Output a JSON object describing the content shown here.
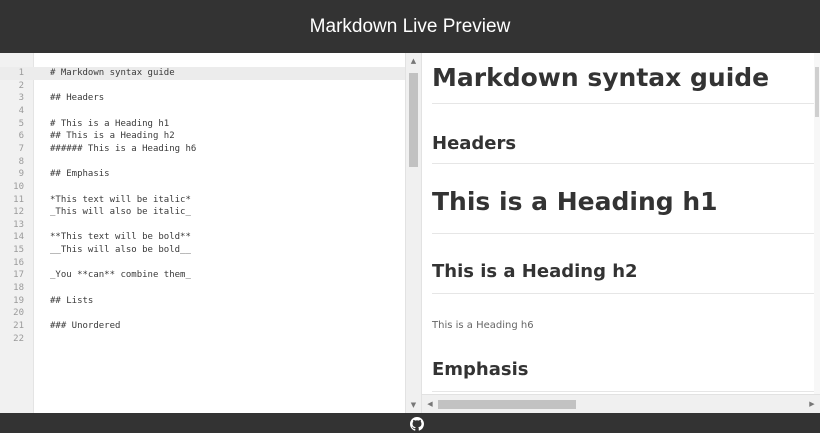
{
  "app": {
    "title": "Markdown Live Preview"
  },
  "editor": {
    "active_line": 1,
    "lines": [
      {
        "n": "1",
        "text": "# Markdown syntax guide"
      },
      {
        "n": "2",
        "text": ""
      },
      {
        "n": "3",
        "text": "## Headers"
      },
      {
        "n": "4",
        "text": ""
      },
      {
        "n": "5",
        "text": "# This is a Heading h1"
      },
      {
        "n": "6",
        "text": "## This is a Heading h2"
      },
      {
        "n": "7",
        "text": "###### This is a Heading h6"
      },
      {
        "n": "8",
        "text": ""
      },
      {
        "n": "9",
        "text": "## Emphasis"
      },
      {
        "n": "10",
        "text": ""
      },
      {
        "n": "11",
        "text": "*This text will be italic*"
      },
      {
        "n": "12",
        "text": "_This will also be italic_"
      },
      {
        "n": "13",
        "text": ""
      },
      {
        "n": "14",
        "text": "**This text will be bold**"
      },
      {
        "n": "15",
        "text": "__This will also be bold__"
      },
      {
        "n": "16",
        "text": ""
      },
      {
        "n": "17",
        "text": "_You **can** combine them_"
      },
      {
        "n": "18",
        "text": ""
      },
      {
        "n": "19",
        "text": "## Lists"
      },
      {
        "n": "20",
        "text": ""
      },
      {
        "n": "21",
        "text": "### Unordered"
      },
      {
        "n": "22",
        "text": ""
      }
    ]
  },
  "preview": {
    "h1_title": "Markdown syntax guide",
    "h2_headers": "Headers",
    "h1_demo": "This is a Heading h1",
    "h2_demo": "This is a Heading h2",
    "h6_demo": "This is a Heading h6",
    "h2_emphasis": "Emphasis"
  },
  "icons": {
    "footer": "github-icon",
    "scroll_up": "triangle-up-icon",
    "scroll_down": "triangle-down-icon",
    "scroll_left": "triangle-left-icon",
    "scroll_right": "triangle-right-icon"
  },
  "colors": {
    "header_bg": "#333333",
    "header_text": "#ffffff",
    "gutter_bg": "#f1f1f1",
    "active_line_bg": "#ececec",
    "preview_text": "#333333"
  }
}
